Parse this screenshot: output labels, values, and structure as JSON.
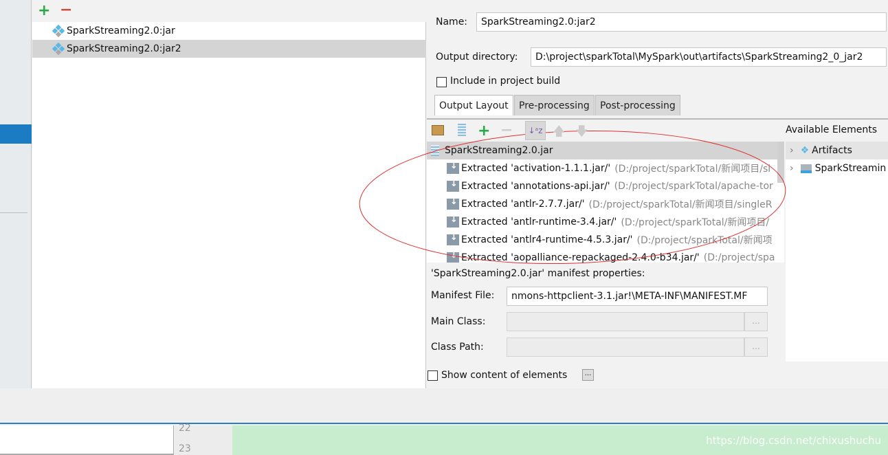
{
  "artifacts_list": {
    "add_icon": "plus-icon",
    "remove_icon": "minus-icon",
    "items": [
      {
        "label": "SparkStreaming2.0:jar",
        "selected": false
      },
      {
        "label": "SparkStreaming2.0:jar2",
        "selected": true
      }
    ]
  },
  "details": {
    "name_label": "Name:",
    "name_value": "SparkStreaming2.0:jar2",
    "output_dir_label": "Output directory:",
    "output_dir_value": "D:\\project\\sparkTotal\\MySpark\\out\\artifacts\\SparkStreaming2_0_jar2",
    "include_build_label": "Include in project build",
    "include_build_checked": false,
    "tabs": [
      "Output Layout",
      "Pre-processing",
      "Post-processing"
    ],
    "active_tab": "Output Layout"
  },
  "layout_tree": {
    "root": "SparkStreaming2.0.jar",
    "rows": [
      {
        "label": "Extracted 'activation-1.1.1.jar/'",
        "path": "(D:/project/sparkTotal/新闻项目/si"
      },
      {
        "label": "Extracted 'annotations-api.jar/'",
        "path": "(D:/project/sparkTotal/apache-tor"
      },
      {
        "label": "Extracted 'antlr-2.7.7.jar/'",
        "path": "(D:/project/sparkTotal/新闻项目/singleR"
      },
      {
        "label": "Extracted 'antlr-runtime-3.4.jar/'",
        "path": "(D:/project/sparkTotal/新闻项目/"
      },
      {
        "label": "Extracted 'antlr4-runtime-4.5.3.jar/'",
        "path": "(D:/project/sparkTotal/新闻项"
      },
      {
        "label": "Extracted 'aopalliance-repackaged-2.4.0-b34.jar/'",
        "path": "(D:/project/spa"
      }
    ]
  },
  "available": {
    "title": "Available Elements",
    "items": [
      "Artifacts",
      "SparkStreamin"
    ]
  },
  "manifest": {
    "title": "'SparkStreaming2.0.jar' manifest properties:",
    "file_label": "Manifest File:",
    "file_value": "nmons-httpclient-3.1.jar!\\META-INF\\MANIFEST.MF",
    "main_class_label": "Main Class:",
    "main_class_value": "",
    "class_path_label": "Class Path:",
    "class_path_value": "",
    "browse_label": "...",
    "show_content_label": "Show content of elements",
    "show_content_checked": false
  },
  "editor": {
    "line_numbers": [
      "22",
      "23"
    ],
    "watermark": "https://blog.csdn.net/chixushuchu"
  },
  "colors": {
    "accent": "#1b7cc4",
    "annotation": "#e03030",
    "code_bg": "#c8ecce"
  }
}
